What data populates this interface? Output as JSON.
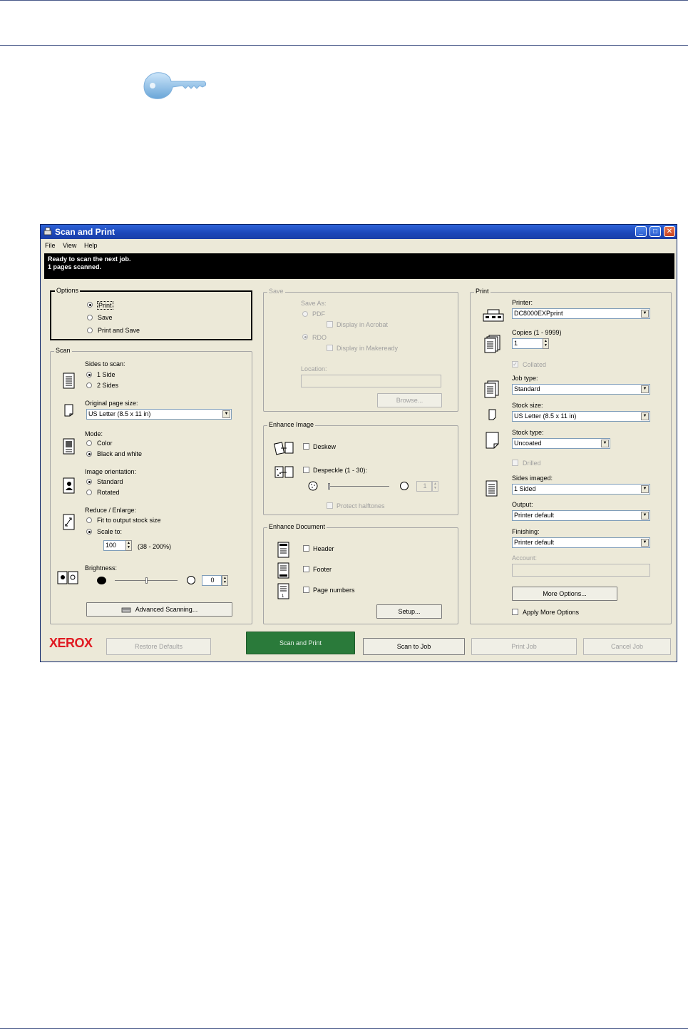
{
  "window": {
    "title": "Scan and Print",
    "menu": [
      "File",
      "View",
      "Help"
    ],
    "status_lines": [
      "Ready to scan the next job.",
      "1 pages scanned."
    ]
  },
  "options": {
    "label": "Options",
    "print": "Print",
    "save": "Save",
    "print_and_save": "Print and Save",
    "selected": "Print"
  },
  "scan": {
    "label": "Scan",
    "sides_label": "Sides to scan:",
    "side1": "1 Side",
    "side2": "2 Sides",
    "page_size_label": "Original page size:",
    "page_size": "US Letter (8.5 x 11 in)",
    "mode_label": "Mode:",
    "mode_color": "Color",
    "mode_bw": "Black and white",
    "orientation_label": "Image orientation:",
    "orient_standard": "Standard",
    "orient_rotated": "Rotated",
    "reduce_label": "Reduce / Enlarge:",
    "fit": "Fit to output stock size",
    "scale_to": "Scale to:",
    "scale_value": "100",
    "scale_range": "(38 - 200%)",
    "brightness_label": "Brightness:",
    "brightness_value": "0",
    "advanced": "Advanced Scanning..."
  },
  "save": {
    "label": "Save",
    "save_as": "Save As:",
    "pdf": "PDF",
    "display_acrobat": "Display in Acrobat",
    "rdo": "RDO",
    "display_makeready": "Display in Makeready",
    "location_label": "Location:",
    "location_value": "",
    "browse": "Browse..."
  },
  "enhance_image": {
    "label": "Enhance Image",
    "deskew": "Deskew",
    "despeckle": "Despeckle (1 - 30):",
    "despeckle_value": "1",
    "protect": "Protect halftones"
  },
  "enhance_document": {
    "label": "Enhance Document",
    "header": "Header",
    "footer": "Footer",
    "page_numbers": "Page numbers",
    "setup": "Setup..."
  },
  "print": {
    "label": "Print",
    "printer_label": "Printer:",
    "printer": "DC8000EXPprint",
    "copies_label": "Copies (1 - 9999)",
    "copies": "1",
    "collated": "Collated",
    "job_type_label": "Job type:",
    "job_type": "Standard",
    "stock_size_label": "Stock size:",
    "stock_size": "US Letter (8.5 x 11 in)",
    "stock_type_label": "Stock type:",
    "stock_type": "Uncoated",
    "drilled": "Drilled",
    "sides_imaged_label": "Sides imaged:",
    "sides_imaged": "1 Sided",
    "output_label": "Output:",
    "output": "Printer default",
    "finishing_label": "Finishing:",
    "finishing": "Printer default",
    "account_label": "Account:",
    "account_value": "",
    "more_options": "More Options...",
    "apply_more": "Apply More Options"
  },
  "footer": {
    "brand": "XEROX",
    "restore": "Restore Defaults",
    "scan_print": "Scan and Print",
    "scan_job": "Scan to Job",
    "print_job": "Print Job",
    "cancel_job": "Cancel Job"
  },
  "colors": {
    "title_bar": "#1b46b8",
    "scan_print_button": "#2a7a3a",
    "brand": "#e01a22"
  }
}
